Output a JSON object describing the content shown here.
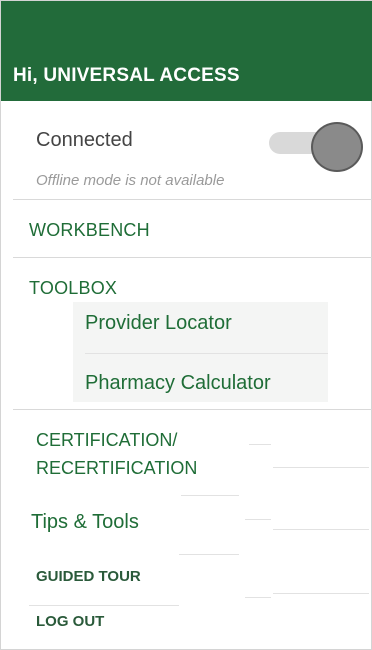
{
  "header": {
    "greeting": "Hi, UNIVERSAL ACCESS",
    "color": "#226b3a"
  },
  "connection": {
    "label": "Connected",
    "note": "Offline mode is not available",
    "toggle_on": true
  },
  "menu": {
    "workbench": "WORKBENCH",
    "toolbox": "TOOLBOX",
    "toolbox_items": [
      "Provider Locator",
      "Pharmacy Calculator"
    ],
    "certification_line1": "CERTIFICATION/",
    "certification_line2": "RECERTIFICATION",
    "tips": "Tips & Tools",
    "guided_tour": "GUIDED TOUR",
    "log_out": "LOG OUT"
  }
}
